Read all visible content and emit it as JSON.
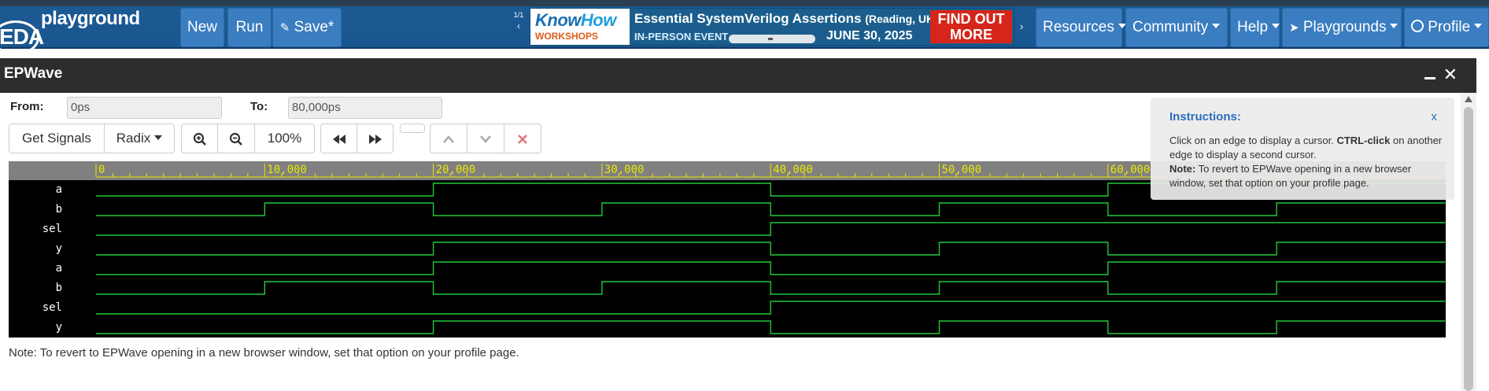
{
  "navbar": {
    "logo_eda": "EDA",
    "logo_text": "playground",
    "new_label": "New",
    "run_label": "Run",
    "save_label": "Save*",
    "pager": "1/1",
    "resources_label": "Resources",
    "community_label": "Community",
    "help_label": "Help",
    "playgrounds_label": "Playgrounds",
    "profile_label": "Profile"
  },
  "banner": {
    "brand_part1": "Know",
    "brand_part2": "How",
    "brand_sub": "WORKSHOPS",
    "title": "Essential SystemVerilog Assertions",
    "title_loc": "(Reading, UK)",
    "event": "IN-PERSON EVENT",
    "date": "JUNE 30, 2025",
    "cta": "FIND OUT MORE"
  },
  "window": {
    "title": "EPWave"
  },
  "range": {
    "from_label": "From:",
    "from_value": "0ps",
    "to_label": "To:",
    "to_value": "80,000ps"
  },
  "toolbar": {
    "get_signals": "Get Signals",
    "radix": "Radix",
    "zoom_level": "100%"
  },
  "instructions": {
    "heading": "Instructions:",
    "close": "x",
    "line1_a": "Click on an edge to display a cursor. ",
    "line1_b": "CTRL-click",
    "line1_c": " on another edge to display a second cursor.",
    "line2_a": "Note:",
    "line2_b": " To revert to EPWave opening in a new browser window, set that option on your profile page."
  },
  "footnote": "Note: To revert to EPWave opening in a new browser window, set that option on your profile page.",
  "colors": {
    "wave": "#22c83a",
    "wave_low": "#2ec9d6",
    "ruler_text": "#e8e800",
    "ruler_bg": "#808080",
    "navbar": "#1a5690"
  },
  "ruler_labels": [
    "0",
    "10,000",
    "20,000",
    "30,000",
    "40,000",
    "50,000",
    "60,000"
  ],
  "signals": [
    {
      "name": "a",
      "values": [
        0,
        0,
        1,
        1,
        0,
        0,
        1,
        1
      ]
    },
    {
      "name": "b",
      "values": [
        0,
        1,
        0,
        1,
        0,
        1,
        0,
        1
      ]
    },
    {
      "name": "sel",
      "values": [
        0,
        0,
        0,
        0,
        1,
        1,
        1,
        1
      ]
    },
    {
      "name": "y",
      "values": [
        0,
        0,
        1,
        1,
        0,
        1,
        0,
        1
      ]
    },
    {
      "name": "a",
      "values": [
        0,
        0,
        1,
        1,
        0,
        0,
        1,
        1
      ]
    },
    {
      "name": "b",
      "values": [
        0,
        1,
        0,
        1,
        0,
        1,
        0,
        1
      ]
    },
    {
      "name": "sel",
      "values": [
        0,
        0,
        0,
        0,
        1,
        1,
        1,
        1
      ]
    },
    {
      "name": "y",
      "values": [
        0,
        0,
        1,
        1,
        0,
        1,
        0,
        1
      ]
    }
  ]
}
